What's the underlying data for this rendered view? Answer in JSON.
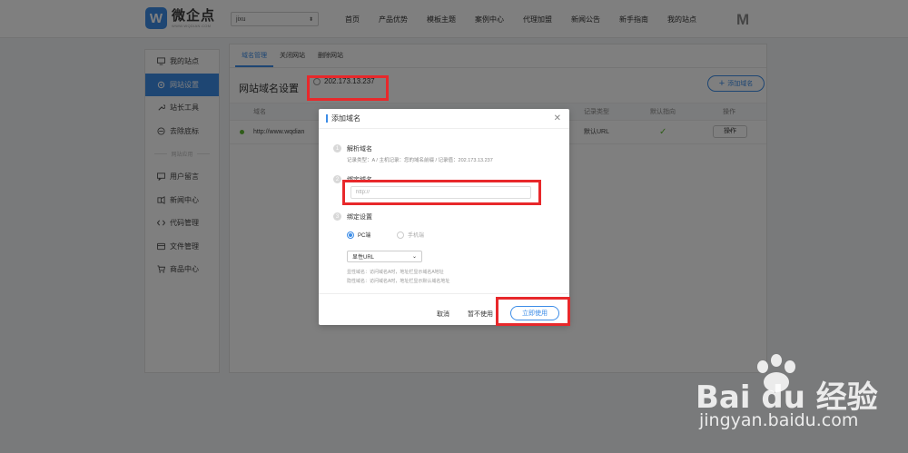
{
  "brand": {
    "name": "微企点",
    "sub": "WWW.WQDIAN.COM",
    "mark": "W"
  },
  "site_select": {
    "value": "jixu"
  },
  "nav": [
    "首页",
    "产品优势",
    "模板主题",
    "案例中心",
    "代理加盟",
    "新闻公告",
    "新手指南",
    "我的站点"
  ],
  "top_right_icon": "M",
  "sidebar": {
    "items": [
      {
        "label": "我的站点",
        "icon": "monitor-icon"
      },
      {
        "label": "网站设置",
        "icon": "gear-icon"
      },
      {
        "label": "站长工具",
        "icon": "wrench-icon"
      },
      {
        "label": "去除底标",
        "icon": "circle-icon"
      }
    ],
    "divider": "网站应用",
    "apps": [
      {
        "label": "用户留言",
        "icon": "message-icon"
      },
      {
        "label": "新闻中心",
        "icon": "news-icon"
      },
      {
        "label": "代码管理",
        "icon": "code-icon"
      },
      {
        "label": "文件管理",
        "icon": "file-icon"
      },
      {
        "label": "商品中心",
        "icon": "cart-icon"
      }
    ]
  },
  "tabs": [
    "域名管理",
    "关闭网站",
    "删除网站"
  ],
  "section_title": "网站域名设置",
  "ip_address": "202.173.13.237",
  "add_domain_label": "添加域名",
  "table": {
    "headers": [
      "域名",
      "记录类型",
      "默认指向",
      "操作"
    ],
    "rows": [
      {
        "domain": "http://www.wqdian",
        "record_type": "默认URL",
        "default": "✓",
        "ops": "操作"
      }
    ]
  },
  "modal": {
    "title": "添加域名",
    "step1": {
      "num": "1",
      "title": "解析域名",
      "desc": "记录类型：A / 主机记录：您的域名前缀 / 记录值：202.173.13.237"
    },
    "step2": {
      "num": "2",
      "title": "绑定域名",
      "placeholder": "http://"
    },
    "step3": {
      "num": "3",
      "title": "绑定设置"
    },
    "radio_pc": "PC端",
    "radio_mobile": "手机端",
    "url_select": "显性URL",
    "help1": "显性域名：访问域名A时，地址栏显示域名A地址",
    "help2": "隐性域名：访问域名A时，地址栏显示默认域名地址",
    "cancel": "取消",
    "not_now": "暂不使用",
    "use_now": "立即使用"
  },
  "watermark": {
    "brand": "Bai du 经验",
    "url": "jingyan.baidu.com"
  },
  "colors": {
    "accent": "#3c8ce7",
    "highlight": "#e8282b",
    "success": "#5fb932"
  }
}
